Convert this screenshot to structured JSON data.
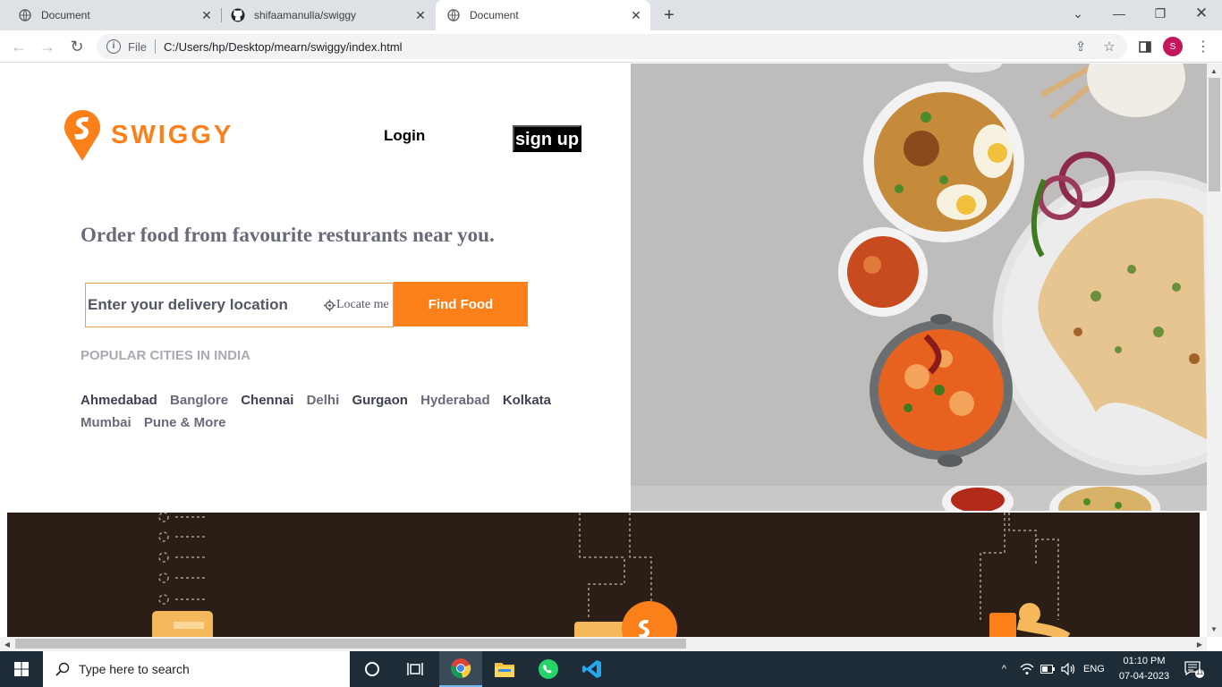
{
  "browser": {
    "tabs": [
      {
        "title": "Document",
        "active": false,
        "icon": "globe-icon"
      },
      {
        "title": "shifaamanulla/swiggy",
        "active": false,
        "icon": "github-icon"
      },
      {
        "title": "Document",
        "active": true,
        "icon": "globe-icon"
      }
    ],
    "address": {
      "scheme_label": "File",
      "url": "C:/Users/hp/Desktop/mearn/swiggy/index.html"
    },
    "profile_initial": "S"
  },
  "page": {
    "logo_text": "SWIGGY",
    "nav": {
      "login": "Login",
      "signup": "sign up"
    },
    "headline": "Order food from favourite resturants near you.",
    "search": {
      "placeholder": "Enter your delivery location",
      "locate_label": "Locate me",
      "find_button": "Find Food"
    },
    "popular_title": "POPULAR CITIES IN INDIA",
    "cities": [
      "Ahmedabad",
      "Banglore",
      "Chennai",
      "Delhi",
      "Gurgaon",
      "Hyderabad",
      "Kolkata",
      "Mumbai",
      "Pune & More"
    ],
    "colors": {
      "brand": "#fc8019",
      "dark_strip": "#2b1e16"
    }
  },
  "taskbar": {
    "search_placeholder": "Type here to search",
    "language": "ENG",
    "time": "01:10 PM",
    "date": "07-04-2023",
    "notification_count": "11"
  }
}
